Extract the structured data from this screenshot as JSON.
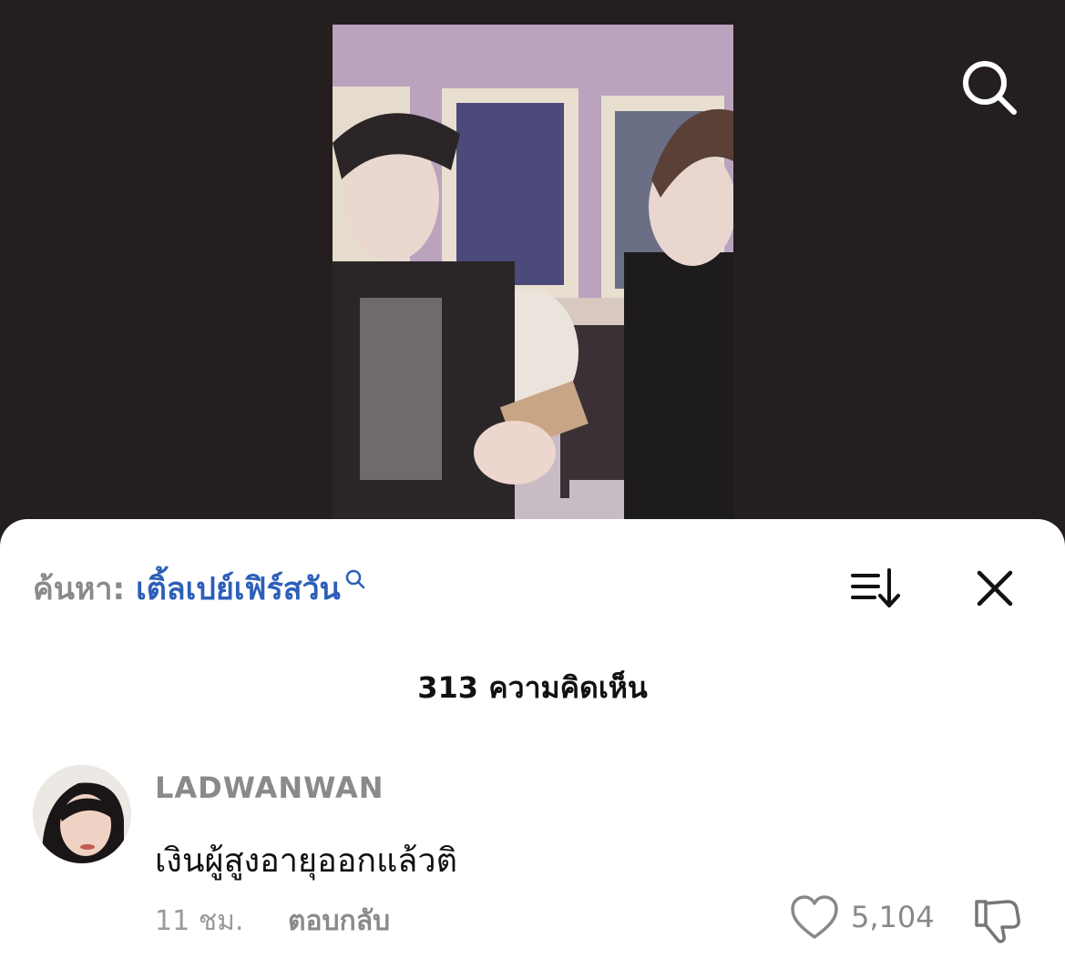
{
  "video": {
    "description_icon": "search-icon"
  },
  "sheet": {
    "search_prefix": "ค้นหา:",
    "search_term": "เติ้ลเปย์เฟิร์สวัน",
    "comment_count_label": "313 ความคิดเห็น"
  },
  "comments": [
    {
      "username": "LADWANWAN",
      "text": "เงินผู้สูงอายุออกแล้วติ",
      "time": "11 ชม.",
      "reply_label": "ตอบกลับ",
      "likes": "5,104"
    }
  ],
  "colors": {
    "background": "#241e1f",
    "link": "#2d5fb8",
    "muted": "#8a8a8a"
  }
}
